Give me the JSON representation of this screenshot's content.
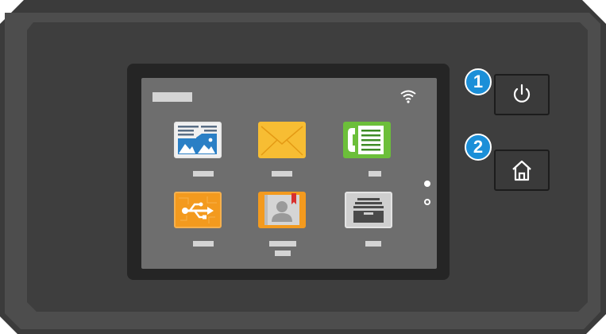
{
  "panel": {
    "bezel_color": "#4a4a4a",
    "bezel_inner_color": "#3d3d3d",
    "screen_color": "#6e6e6e"
  },
  "screen": {
    "wifi_icon": "wifi-icon",
    "apps": [
      {
        "icon": "copy-icon",
        "color": "#e6e6e6"
      },
      {
        "icon": "email-icon",
        "color": "#f6b82f"
      },
      {
        "icon": "fax-icon",
        "color": "#6cbf3a"
      },
      {
        "icon": "usb-icon",
        "color": "#f39a1e"
      },
      {
        "icon": "address-book-icon",
        "color": "#f39a1e"
      },
      {
        "icon": "job-tray-icon",
        "color": "#cfcfcf"
      }
    ],
    "pages": {
      "total": 2,
      "current": 1
    }
  },
  "buttons": {
    "power": {
      "icon": "power-icon",
      "callout": "1"
    },
    "home": {
      "icon": "home-icon",
      "callout": "2"
    }
  },
  "callout_color": "#1b8fd8"
}
